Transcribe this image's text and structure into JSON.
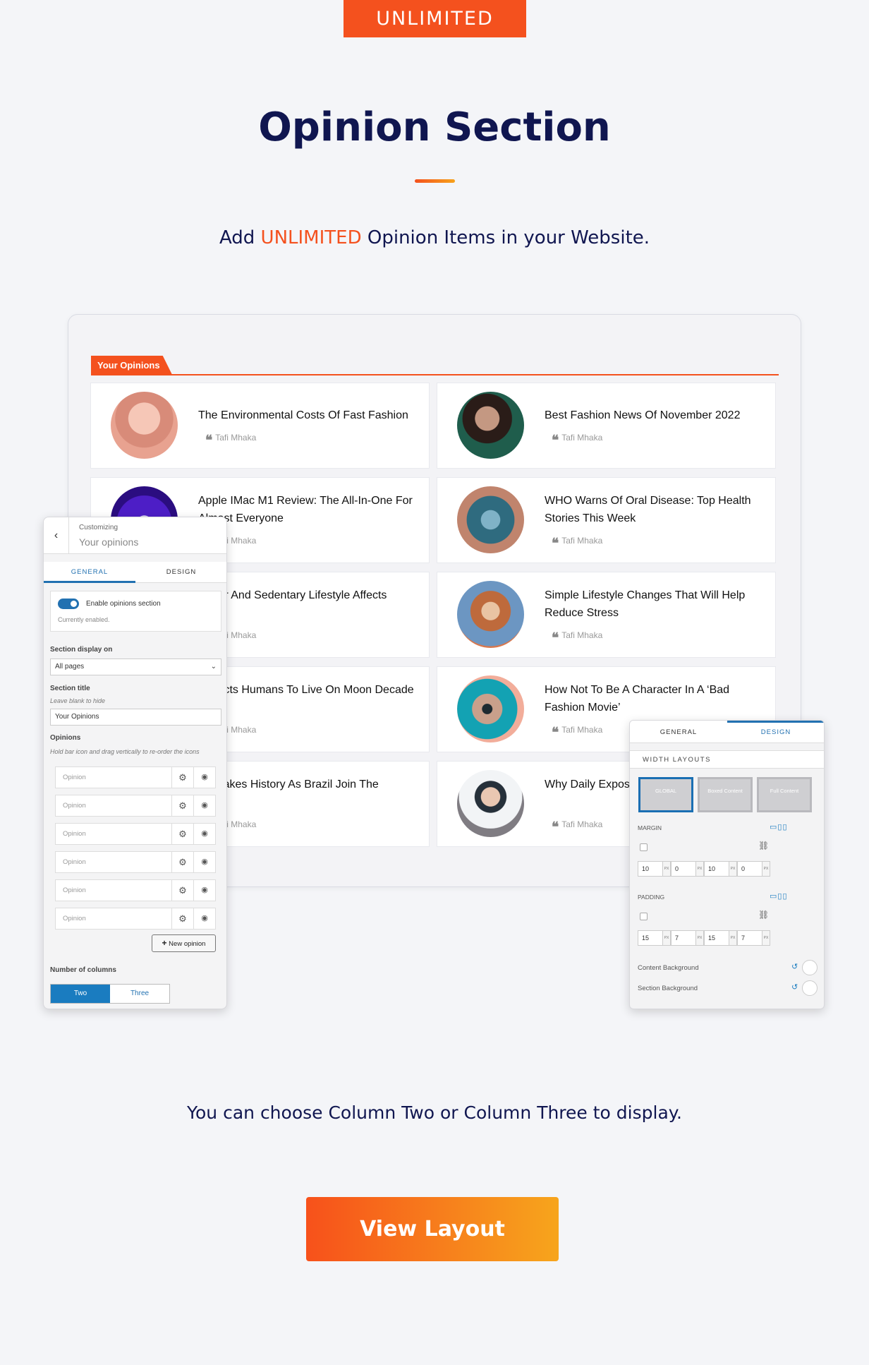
{
  "badge": "UNLIMITED",
  "title": "Opinion Section",
  "subtitle": {
    "prefix": "Add",
    "highlight": "UNLIMITED",
    "suffix": "Opinion Items in your Website."
  },
  "colors": {
    "accent": "#f4511e",
    "navy": "#101650",
    "wp_blue": "#2271b1"
  },
  "opinions": {
    "heading": "Your Opinions",
    "quote_icon": "quote-icon",
    "items": [
      {
        "title": "The Environmental Costs Of Fast Fashion",
        "author": "Tafi Mhaka"
      },
      {
        "title": "Best Fashion News Of November 2022",
        "author": "Tafi Mhaka"
      },
      {
        "title": "Apple IMac M1 Review: The All-In-One For Almost Everyone",
        "author": "Tafi Mhaka"
      },
      {
        "title": "WHO Warns Of Oral Disease: Top Health Stories This Week",
        "author": "Tafi Mhaka"
      },
      {
        "title": "Sugar And Sedentary Lifestyle Affects",
        "author": "Tafi Mhaka"
      },
      {
        "title": "Simple Lifestyle Changes That Will Help Reduce Stress",
        "author": "Tafi Mhaka"
      },
      {
        "title": "Expects Humans To Live On Moon Decade",
        "author": "Tafi Mhaka"
      },
      {
        "title": "How Not To Be A Character In A ‘Bad Fashion Movie’",
        "author": "Tafi Mhaka"
      },
      {
        "title": "do Makes History As Brazil Join The",
        "author": "Tafi Mhaka"
      },
      {
        "title": "Why Daily Expos For Your Health",
        "author": "Tafi Mhaka"
      }
    ]
  },
  "customizer": {
    "breadcrumb": "Customizing",
    "section": "Your opinions",
    "tabs": [
      "GENERAL",
      "DESIGN"
    ],
    "enable_label": "Enable opinions section",
    "enable_note": "Currently enabled.",
    "display_label": "Section display on",
    "display_value": "All pages",
    "title_label": "Section title",
    "title_note": "Leave blank to hide",
    "title_value": "Your Opinions",
    "opinions_label": "Opinions",
    "opinions_note": "Hold bar icon and drag vertically to re-order the icons",
    "opinion_items": [
      "Opinion",
      "Opinion",
      "Opinion",
      "Opinion",
      "Opinion",
      "Opinion"
    ],
    "new_button": "New opinion",
    "columns_label": "Number of columns",
    "columns": [
      "Two",
      "Three"
    ],
    "columns_selected": "Two"
  },
  "design": {
    "tabs": [
      "GENERAL",
      "DESIGN"
    ],
    "width_layouts_label": "WIDTH LAYOUTS",
    "layouts": [
      "GLOBAL",
      "Boxed Content",
      "Full Content"
    ],
    "margin_label": "MARGIN",
    "margin": {
      "values": [
        "10",
        "0",
        "10",
        "0"
      ],
      "unit": "PX"
    },
    "padding_label": "PADDING",
    "padding": {
      "values": [
        "15",
        "7",
        "15",
        "7"
      ],
      "unit": "PX"
    },
    "content_bg": "Content Background",
    "section_bg": "Section Background"
  },
  "bottom_text": "You can choose Column Two or Column Three to display.",
  "cta": "View Layout"
}
